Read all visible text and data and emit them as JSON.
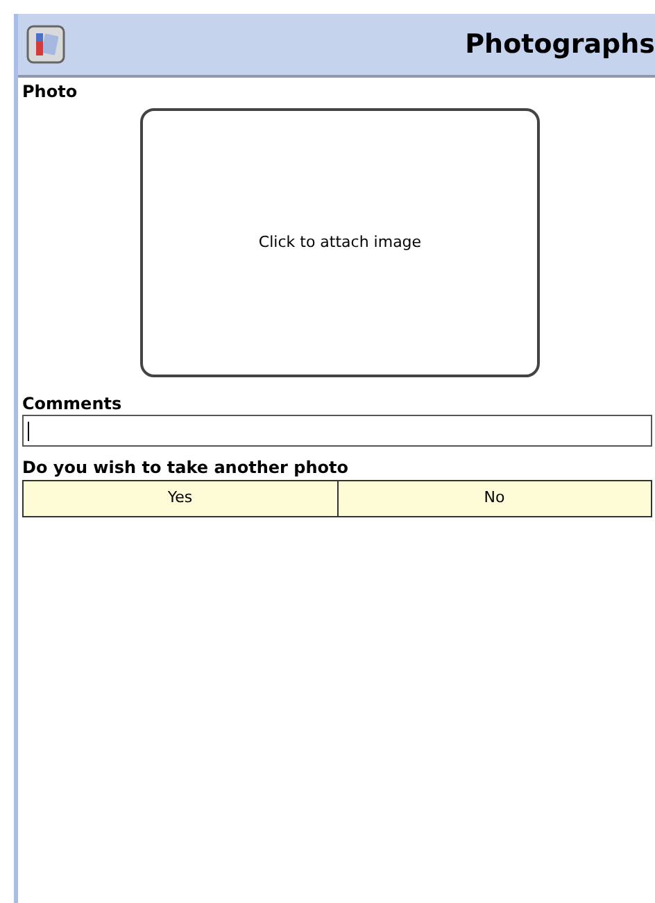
{
  "header": {
    "title": "Photographs"
  },
  "photo": {
    "label": "Photo",
    "placeholder": "Click to attach image"
  },
  "comments": {
    "label": "Comments"
  },
  "question": {
    "label": "Do you wish to take another photo",
    "options": [
      "Yes",
      "No"
    ]
  }
}
